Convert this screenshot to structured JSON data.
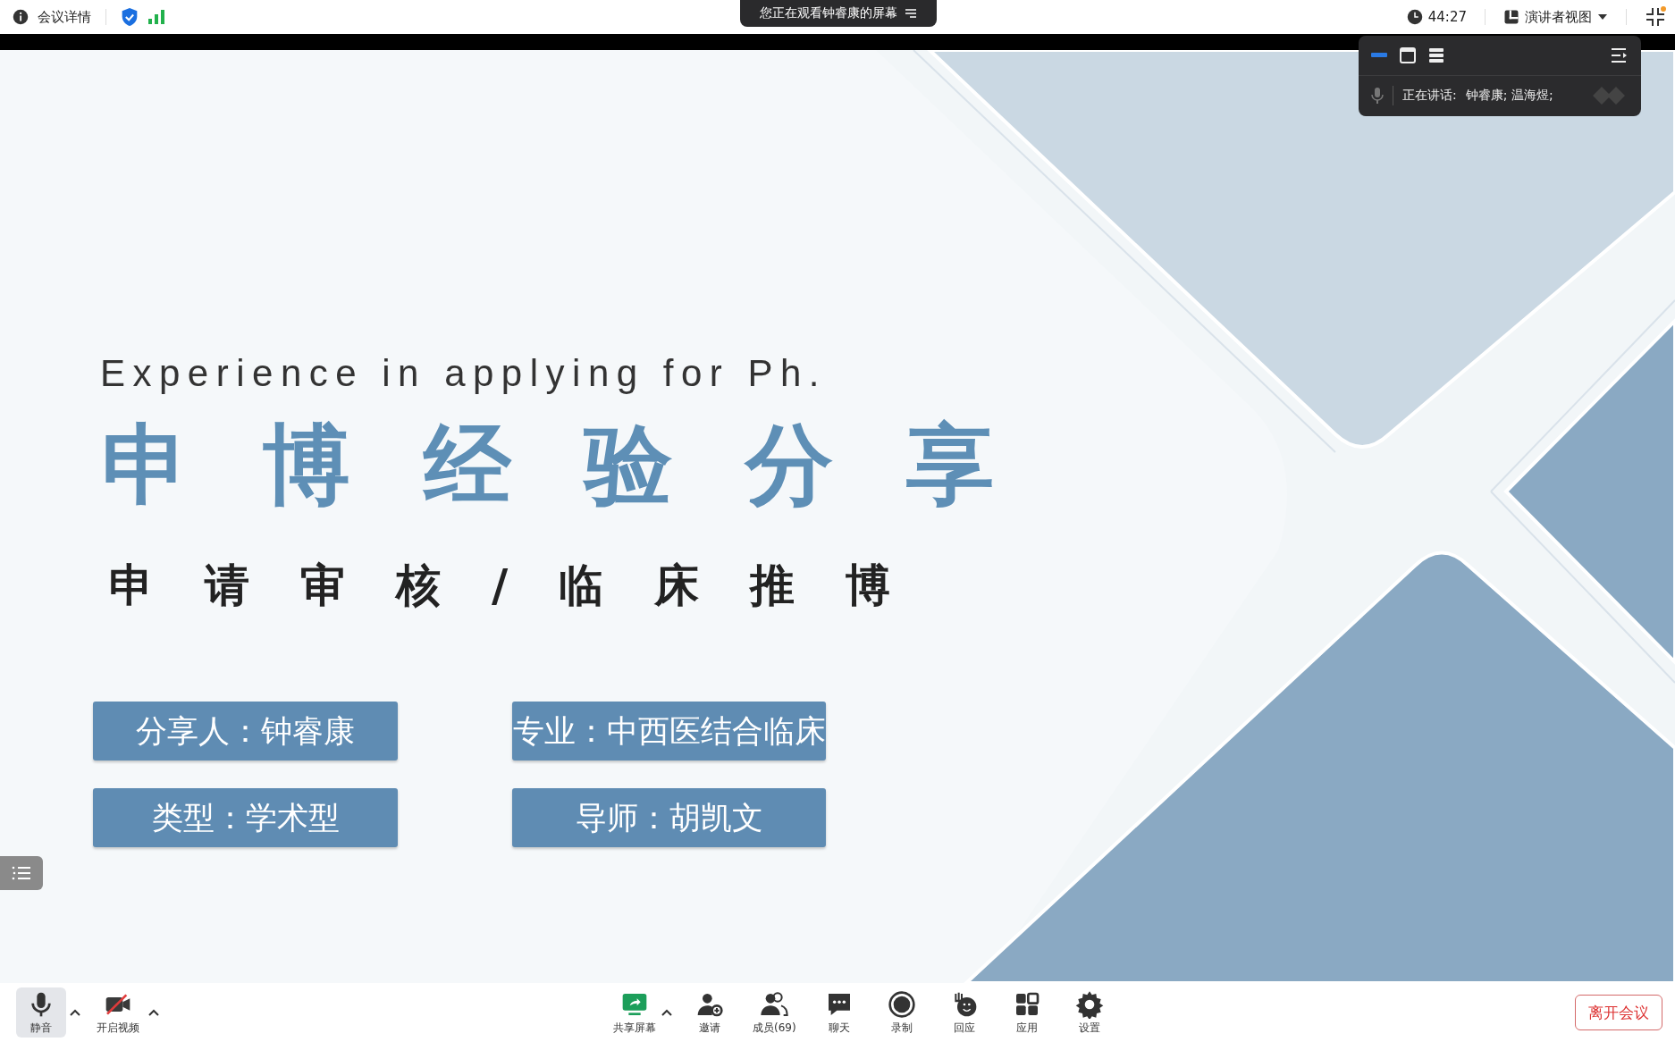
{
  "top_bar": {
    "meeting_info": "会议详情",
    "sharing_banner": "您正在观看钟睿康的屏幕",
    "timer": "44:27",
    "view_mode": "演讲者视图"
  },
  "speaker_panel": {
    "label": "正在讲话:",
    "speakers": "钟睿康; 温海煜;"
  },
  "slide": {
    "subtitle_en": "Experience in applying for Ph.",
    "title": "申博经验分享",
    "subtitle": "申请审核/临床推博",
    "info_boxes": [
      {
        "text": "分享人：钟睿康"
      },
      {
        "text": "专业：中西医结合临床"
      },
      {
        "text": "类型：学术型"
      },
      {
        "text": "导师：胡凯文"
      }
    ]
  },
  "toolbar": {
    "left": [
      {
        "kind": "mic",
        "label": "静音",
        "highlighted": true,
        "menu": true
      },
      {
        "kind": "video_off",
        "label": "开启视频",
        "highlighted": false,
        "menu": true
      }
    ],
    "center": [
      {
        "kind": "share",
        "label": "共享屏幕",
        "menu": true
      },
      {
        "kind": "invite",
        "label": "邀请",
        "menu": false
      },
      {
        "kind": "members",
        "label": "成员(69)",
        "menu": false
      },
      {
        "kind": "chat",
        "label": "聊天",
        "menu": false
      },
      {
        "kind": "record",
        "label": "录制",
        "menu": false
      },
      {
        "kind": "react",
        "label": "回应",
        "menu": false
      },
      {
        "kind": "apps",
        "label": "应用",
        "menu": false
      },
      {
        "kind": "settings",
        "label": "设置",
        "menu": false
      }
    ],
    "leave_button": "离开会议"
  }
}
